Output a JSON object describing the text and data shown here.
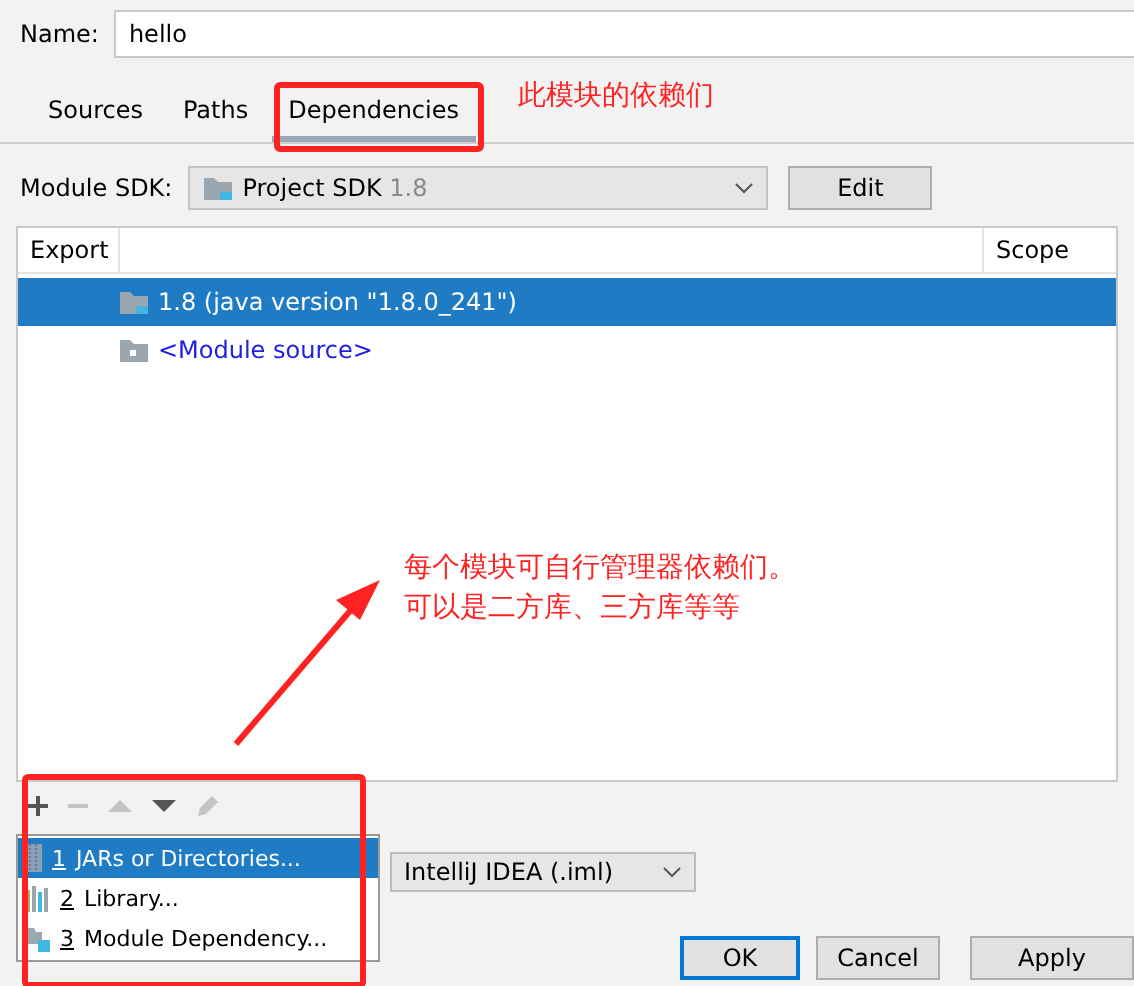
{
  "name_field": {
    "label": "Name:",
    "value": "hello"
  },
  "tabs": [
    {
      "label": "Sources",
      "selected": false
    },
    {
      "label": "Paths",
      "selected": false
    },
    {
      "label": "Dependencies",
      "selected": true
    }
  ],
  "module_sdk": {
    "label": "Module SDK:",
    "value": "Project SDK",
    "version": "1.8"
  },
  "edit_button": "Edit",
  "table": {
    "columns": [
      "Export",
      "Scope"
    ],
    "rows": [
      {
        "kind": "sdk",
        "text": "1.8 (java version \"1.8.0_241\")",
        "selected": true
      },
      {
        "kind": "source",
        "text": "<Module source>",
        "selected": false
      }
    ]
  },
  "toolbar": [
    {
      "kind": "add",
      "disabled": false
    },
    {
      "kind": "remove",
      "disabled": true
    },
    {
      "kind": "up",
      "disabled": true
    },
    {
      "kind": "down",
      "disabled": false
    },
    {
      "kind": "edit",
      "disabled": true
    }
  ],
  "add_menu": [
    {
      "kind": "jar",
      "number": "1",
      "label": "JARs or Directories...",
      "selected": true
    },
    {
      "kind": "library",
      "number": "2",
      "label": "Library...",
      "selected": false
    },
    {
      "kind": "module",
      "number": "3",
      "label": "Module Dependency...",
      "selected": false
    }
  ],
  "format_dropdown": {
    "value": "IntelliJ IDEA (.iml)"
  },
  "buttons": [
    {
      "label": "OK",
      "kind": "default"
    },
    {
      "label": "Cancel",
      "kind": "normal"
    },
    {
      "label": "Apply",
      "kind": "normal"
    }
  ],
  "annotations": [
    {
      "text": "此模块的依赖们"
    },
    {
      "text": "每个模块可自行管理器依赖们。"
    },
    {
      "text": "可以是二方库、三方库等等"
    }
  ]
}
